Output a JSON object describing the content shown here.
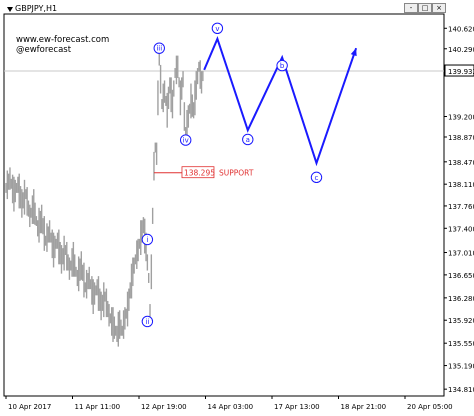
{
  "window": {
    "title": "GBPJPY,H1",
    "buttons": [
      "-",
      "□",
      "×"
    ]
  },
  "watermark": {
    "line1": "www.ew-forecast.com",
    "line2": "@ewforecast"
  },
  "chart_data": {
    "type": "line",
    "symbol": "GBPJPY",
    "timeframe": "H1",
    "y_ticks": [
      "140.620",
      "140.290",
      "139.932",
      "139.200",
      "138.870",
      "138.470",
      "138.110",
      "137.760",
      "137.400",
      "137.010",
      "136.650",
      "136.280",
      "135.920",
      "135.550",
      "135.190",
      "134.810"
    ],
    "current_price": "139.932",
    "x_ticks": [
      "10 Apr 2017",
      "11 Apr 11:00",
      "12 Apr 19:00",
      "14 Apr 03:00",
      "17 Apr 13:00",
      "18 Apr 21:00",
      "20 Apr 05:00"
    ],
    "ylim": [
      134.7,
      140.85
    ],
    "price_path": [
      [
        0,
        138.05
      ],
      [
        3,
        138.2
      ],
      [
        6,
        137.95
      ],
      [
        9,
        138.1
      ],
      [
        12,
        137.8
      ],
      [
        15,
        137.95
      ],
      [
        18,
        137.6
      ],
      [
        21,
        137.75
      ],
      [
        24,
        137.4
      ],
      [
        27,
        137.55
      ],
      [
        30,
        137.2
      ],
      [
        33,
        137.35
      ],
      [
        36,
        137.05
      ],
      [
        39,
        137.2
      ],
      [
        42,
        136.9
      ],
      [
        45,
        137.05
      ],
      [
        48,
        136.75
      ],
      [
        51,
        136.9
      ],
      [
        54,
        136.6
      ],
      [
        57,
        136.8
      ],
      [
        60,
        136.45
      ],
      [
        63,
        136.6
      ],
      [
        66,
        136.3
      ],
      [
        69,
        136.45
      ],
      [
        72,
        136.15
      ],
      [
        75,
        136.3
      ],
      [
        78,
        136.0
      ],
      [
        81,
        135.85
      ],
      [
        84,
        135.7
      ],
      [
        86,
        135.85
      ],
      [
        88,
        135.75
      ],
      [
        90,
        135.95
      ],
      [
        92,
        136.1
      ],
      [
        94,
        136.4
      ],
      [
        96,
        136.7
      ],
      [
        98,
        136.9
      ],
      [
        100,
        137.05
      ],
      [
        102,
        137.25
      ],
      [
        104,
        137.45
      ],
      [
        106,
        137.1
      ],
      [
        108,
        136.6
      ],
      [
        109,
        136.0
      ],
      [
        110,
        136.7
      ],
      [
        111,
        137.6
      ],
      [
        112,
        138.4
      ],
      [
        113,
        138.7
      ],
      [
        114,
        138.6
      ],
      [
        115,
        139.5
      ],
      [
        116,
        140.15
      ],
      [
        117,
        139.8
      ],
      [
        118,
        139.4
      ],
      [
        120,
        139.6
      ],
      [
        122,
        139.3
      ],
      [
        124,
        139.7
      ],
      [
        126,
        139.4
      ],
      [
        128,
        139.9
      ],
      [
        130,
        140.0
      ],
      [
        132,
        139.5
      ],
      [
        134,
        139.8
      ],
      [
        135,
        139.2
      ],
      [
        136,
        138.95
      ],
      [
        138,
        139.2
      ],
      [
        140,
        139.45
      ],
      [
        142,
        139.3
      ],
      [
        144,
        139.7
      ],
      [
        146,
        140.0
      ],
      [
        148,
        139.75
      ],
      [
        150,
        139.95
      ]
    ],
    "projection": [
      {
        "x": 150,
        "y": 139.95
      },
      {
        "x": 160,
        "y": 140.45
      },
      {
        "x": 183,
        "y": 138.98
      },
      {
        "x": 209,
        "y": 140.15
      },
      {
        "x": 235,
        "y": 138.45
      },
      {
        "x": 265,
        "y": 140.3
      }
    ],
    "wave_labels": [
      {
        "text": "i",
        "x": 107,
        "y": 137.22
      },
      {
        "text": "ii",
        "x": 107,
        "y": 135.9
      },
      {
        "text": "iii",
        "x": 116,
        "y": 140.3
      },
      {
        "text": "iv",
        "x": 136,
        "y": 138.82
      },
      {
        "text": "v",
        "x": 160,
        "y": 140.62
      },
      {
        "text": "a",
        "x": 183,
        "y": 138.83
      },
      {
        "text": "b",
        "x": 209,
        "y": 140.02
      },
      {
        "text": "c",
        "x": 235,
        "y": 138.22
      }
    ],
    "support": {
      "value": "138.295",
      "label": "SUPPORT",
      "from_x": 112,
      "to_x": 145
    },
    "x_positions": {
      "domain": [
        0,
        330
      ]
    },
    "colors": {
      "price": "#a0a0a0",
      "projection": "#1a1aff",
      "support": "#e03030",
      "hline": "#c8c8c8"
    },
    "grid": false
  }
}
